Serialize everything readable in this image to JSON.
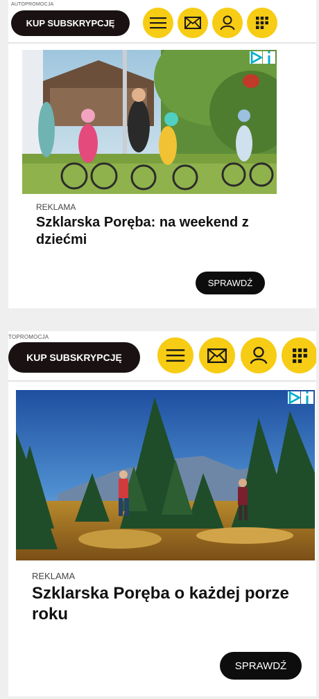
{
  "banner1": {
    "autopromo": "AUTOPROMOCJA",
    "subscribe_label": "KUP SUBSKRYPCJĘ",
    "ad": {
      "reklama": "REKLAMA",
      "headline": "Szklarska Poręba: na weekend z dziećmi",
      "cta": "SPRAWDŹ"
    }
  },
  "banner2": {
    "autopromo": "TOPROMOCJA",
    "subscribe_label": "KUP SUBSKRYPCJĘ",
    "ad": {
      "reklama": "REKLAMA",
      "headline": "Szklarska Poręba o każdej porze roku",
      "cta": "SPRAWDŹ"
    }
  },
  "colors": {
    "accent_yellow": "#f7cc14",
    "subscribe_bg": "#1a1212",
    "cta_bg": "#0d0d0d",
    "adchoice_blue": "#00aecd"
  },
  "icons": [
    "menu-icon",
    "mail-icon",
    "user-icon",
    "apps-grid-icon",
    "adchoices-icon",
    "info-icon"
  ]
}
